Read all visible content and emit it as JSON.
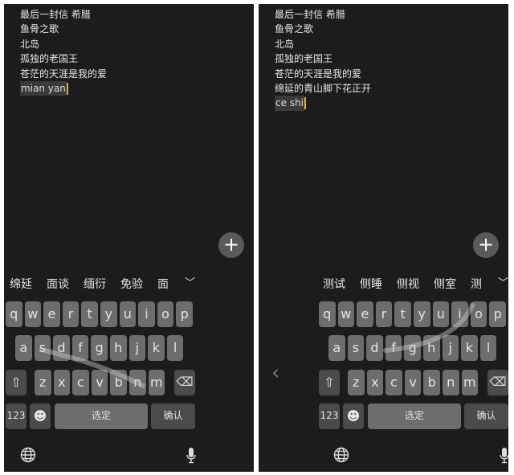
{
  "colors": {
    "panel_bg": "#1c1c1d",
    "key": "#6d6d6f",
    "fn_key": "#4b4b4d",
    "caret": "#f2b400"
  },
  "panels": [
    {
      "lines": [
        "最后一封信 希腊",
        "鱼骨之歌",
        "北岛",
        "孤独的老国王",
        "苍茫的天涯是我的爱"
      ],
      "composing": "mian yan",
      "candidates": [
        "绵延",
        "面谈",
        "缅衍",
        "免验",
        "面"
      ],
      "keyboard_side": "left"
    },
    {
      "lines": [
        "最后一封信 希腊",
        "鱼骨之歌",
        "北岛",
        "孤独的老国王",
        "苍茫的天涯是我的爱",
        "绵延的青山脚下花正开"
      ],
      "composing": "ce shi",
      "candidates": [
        "测试",
        "侧睡",
        "侧视",
        "侧室",
        "测"
      ],
      "keyboard_side": "right"
    }
  ],
  "keyboard": {
    "row1": [
      "q",
      "w",
      "e",
      "r",
      "t",
      "y",
      "u",
      "i",
      "o",
      "p"
    ],
    "row2": [
      "a",
      "s",
      "d",
      "f",
      "g",
      "h",
      "j",
      "k",
      "l"
    ],
    "row3": [
      "z",
      "x",
      "c",
      "v",
      "b",
      "n",
      "m"
    ],
    "shift_icon": "⇧",
    "backspace_icon": "⌫",
    "numbers_label": "123",
    "emoji_icon": "☻",
    "space_label": "选定",
    "confirm_label": "确认",
    "globe_icon": "globe-icon",
    "mic_icon": "microphone-icon",
    "expand_icon": "chevron-down-icon",
    "plus_icon": "+",
    "back_icon": "‹"
  }
}
